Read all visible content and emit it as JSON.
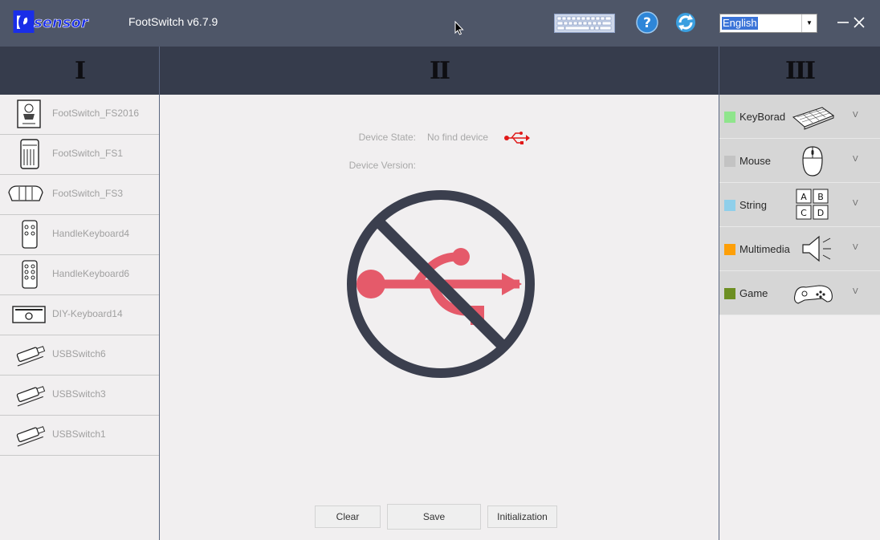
{
  "app": {
    "logo_text": "PCsensor",
    "title": "FootSwitch v6.7.9",
    "language": "English"
  },
  "sections": {
    "left": "I",
    "middle": "II",
    "right": "III"
  },
  "devices": [
    {
      "label": "FootSwitch_FS2016",
      "icon": "footswitch-fs2016-icon"
    },
    {
      "label": "FootSwitch_FS1",
      "icon": "footswitch-fs1-icon"
    },
    {
      "label": "FootSwitch_FS3",
      "icon": "footswitch-fs3-icon"
    },
    {
      "label": "HandleKeyboard4",
      "icon": "handle-keyboard4-icon"
    },
    {
      "label": "HandleKeyboard6",
      "icon": "handle-keyboard6-icon"
    },
    {
      "label": "DIY-Keyboard14",
      "icon": "diy-keyboard-icon"
    },
    {
      "label": "USBSwitch6",
      "icon": "usb-switch-icon"
    },
    {
      "label": "USBSwitch3",
      "icon": "usb-switch-icon"
    },
    {
      "label": "USBSwitch1",
      "icon": "usb-switch-icon"
    }
  ],
  "device_state": {
    "label": "Device State:",
    "value": "No find device",
    "version_label": "Device Version:"
  },
  "buttons": {
    "clear": "Clear",
    "save": "Save",
    "initialization": "Initialization"
  },
  "modes": [
    {
      "label": "KeyBorad",
      "color": "#8fe58c",
      "icon": "keyboard-icon",
      "chevron": "V"
    },
    {
      "label": "Mouse",
      "color": "#c3c3c3",
      "icon": "mouse-icon",
      "chevron": "V"
    },
    {
      "label": "String",
      "color": "#8fcfea",
      "icon": "abcd-keys-icon",
      "chevron": "V",
      "keys": [
        "A",
        "B",
        "C",
        "D"
      ]
    },
    {
      "label": "Multimedia",
      "color": "#fd9f08",
      "icon": "speaker-icon",
      "chevron": "V"
    },
    {
      "label": "Game",
      "color": "#6d8f22",
      "icon": "gamepad-icon",
      "chevron": "V"
    }
  ],
  "colors": {
    "titlebar": "#4e5668",
    "section_header": "#363c4c",
    "logo_blue": "#1a2ee8",
    "usb_red": "#e55a6a",
    "slash_dark": "#3b3f4e"
  }
}
